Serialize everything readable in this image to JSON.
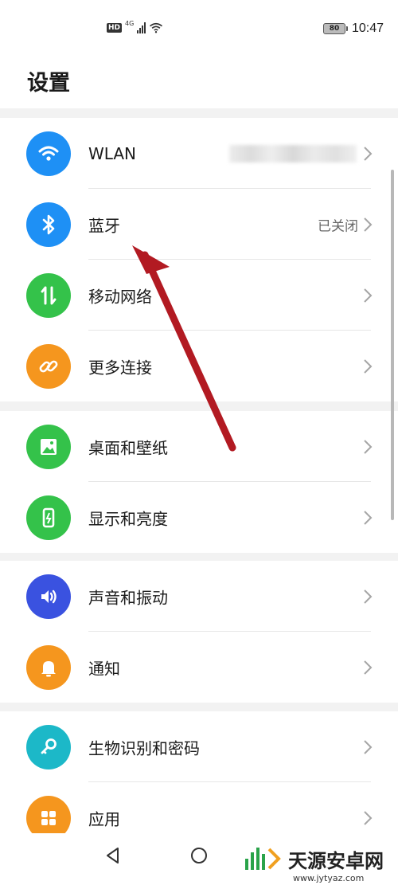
{
  "status_bar": {
    "hd_label": "HD",
    "network_label": "4G",
    "battery": "80",
    "time": "10:47"
  },
  "header": {
    "title": "设置"
  },
  "groups": [
    {
      "items": [
        {
          "label": "WLAN",
          "value": "",
          "icon": "wifi-icon",
          "color": "#1e90f5"
        },
        {
          "label": "蓝牙",
          "value": "已关闭",
          "icon": "bluetooth-icon",
          "color": "#1e90f5"
        },
        {
          "label": "移动网络",
          "value": "",
          "icon": "mobile-data-icon",
          "color": "#34c24a"
        },
        {
          "label": "更多连接",
          "value": "",
          "icon": "link-icon",
          "color": "#f5961e"
        }
      ]
    },
    {
      "items": [
        {
          "label": "桌面和壁纸",
          "value": "",
          "icon": "wallpaper-icon",
          "color": "#34c24a"
        },
        {
          "label": "显示和亮度",
          "value": "",
          "icon": "display-icon",
          "color": "#34c24a"
        }
      ]
    },
    {
      "items": [
        {
          "label": "声音和振动",
          "value": "",
          "icon": "sound-icon",
          "color": "#3a52e0"
        },
        {
          "label": "通知",
          "value": "",
          "icon": "bell-icon",
          "color": "#f5961e"
        }
      ]
    },
    {
      "items": [
        {
          "label": "生物识别和密码",
          "value": "",
          "icon": "key-icon",
          "color": "#1cb8c8"
        },
        {
          "label": "应用",
          "value": "",
          "icon": "apps-icon",
          "color": "#f5961e"
        }
      ]
    }
  ],
  "watermark": {
    "name": "天源安卓网",
    "url": "www.jytyaz.com"
  }
}
